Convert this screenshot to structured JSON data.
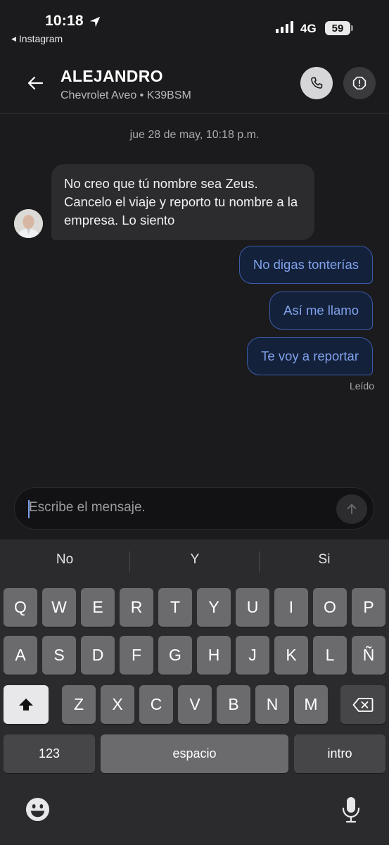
{
  "status_bar": {
    "time": "10:18",
    "back_app": "Instagram",
    "network": "4G",
    "battery": "59"
  },
  "header": {
    "name": "ALEJANDRO",
    "subtitle": "Chevrolet Aveo • K39BSM"
  },
  "chat": {
    "timestamp": "jue 28 de may, 10:18 p.m.",
    "incoming": "No creo que tú nombre sea Zeus. Cancelo el viaje y reporto tu nombre a la empresa. Lo siento",
    "outgoing": [
      "No digas tonterías",
      "Así me llamo",
      "Te voy a reportar"
    ],
    "read_receipt": "Leído"
  },
  "composer": {
    "placeholder": "Escribe el mensaje."
  },
  "keyboard": {
    "suggestions": [
      "No",
      "Y",
      "Si"
    ],
    "row1": [
      "Q",
      "W",
      "E",
      "R",
      "T",
      "Y",
      "U",
      "I",
      "O",
      "P"
    ],
    "row2": [
      "A",
      "S",
      "D",
      "F",
      "G",
      "H",
      "J",
      "K",
      "L",
      "Ñ"
    ],
    "row3": [
      "Z",
      "X",
      "C",
      "V",
      "B",
      "N",
      "M"
    ],
    "numbers_label": "123",
    "space_label": "espacio",
    "return_label": "intro"
  },
  "icons": {
    "location": "location-arrow-icon",
    "back": "back-arrow-icon",
    "call": "phone-icon",
    "report": "alert-icon",
    "send": "arrow-up-icon",
    "shift": "shift-icon",
    "delete": "delete-icon",
    "emoji": "emoji-icon",
    "mic": "microphone-icon"
  },
  "colors": {
    "background": "#1b1b1d",
    "outgoing_border": "#3b5ca8",
    "outgoing_text": "#7fa2ec",
    "incoming_bubble": "#2c2c2f"
  }
}
